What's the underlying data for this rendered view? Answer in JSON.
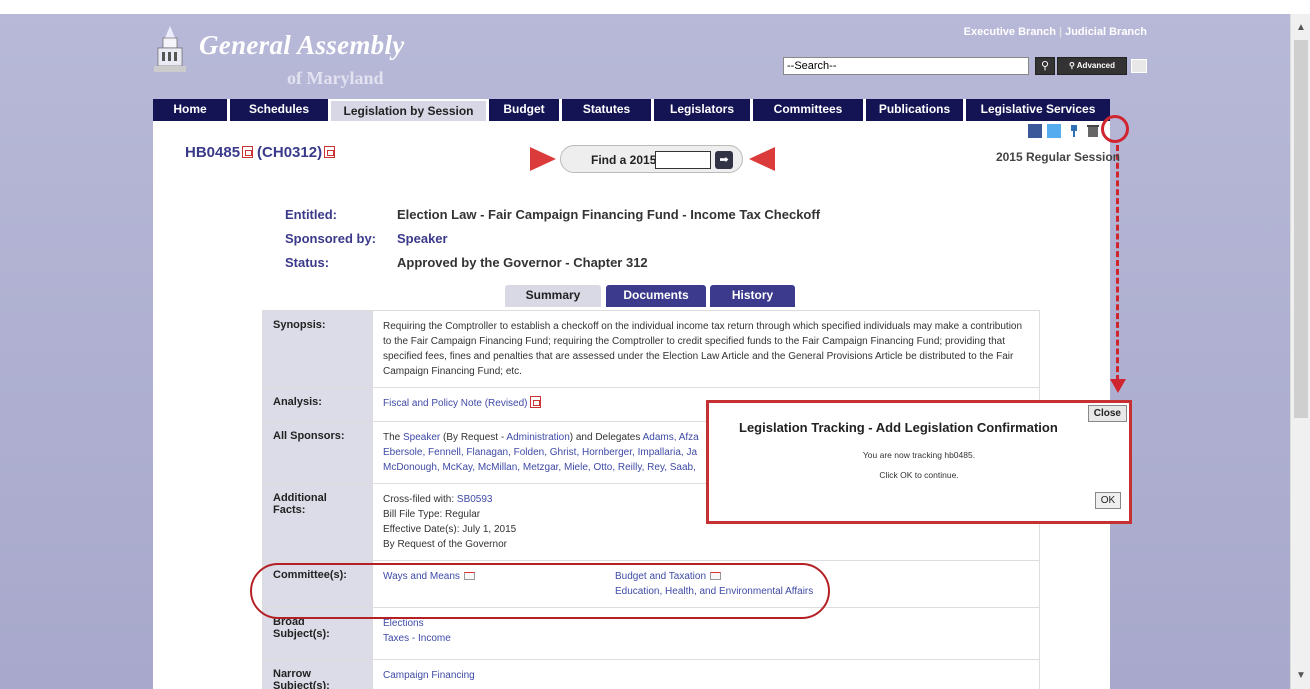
{
  "header": {
    "site_title": "General Assembly",
    "site_subtitle": "of Maryland",
    "branch_links": [
      "Executive Branch",
      "Judicial Branch"
    ],
    "search_placeholder": "--Search--",
    "advanced_label": "Advanced"
  },
  "nav": {
    "items": [
      "Home",
      "Schedules",
      "Legislation by Session",
      "Budget",
      "Statutes",
      "Legislators",
      "Committees",
      "Publications",
      "Legislative Services"
    ]
  },
  "bill": {
    "number": "HB0485",
    "chapter": "(CH0312)",
    "find_label": "Find a 2015 Bill:",
    "session": "2015 Regular Session"
  },
  "meta": {
    "entitled_label": "Entitled:",
    "entitled_value": "Election Law - Fair Campaign Financing Fund - Income Tax Checkoff",
    "sponsored_label": "Sponsored by:",
    "sponsored_value": "Speaker",
    "status_label": "Status:",
    "status_value": "Approved by the Governor - Chapter 312"
  },
  "tabs": [
    "Summary",
    "Documents",
    "History"
  ],
  "rows": {
    "synopsis_label": "Synopsis:",
    "synopsis_text": "Requiring the Comptroller to establish a checkoff on the individual income tax return through which specified individuals may make a contribution to the Fair Campaign Financing Fund; requiring the Comptroller to credit specified funds to the Fair Campaign Financing Fund; providing that specified fees, fines and penalties that are assessed under the Election Law Article and the General Provisions Article be distributed to the Fair Campaign Financing Fund; etc.",
    "analysis_label": "Analysis:",
    "analysis_link": "Fiscal and Policy Note (Revised)",
    "sponsors_label": "All Sponsors:",
    "sponsors_line1_pre": "The ",
    "sponsors_speaker": "Speaker",
    "sponsors_byrequest": " (By Request - ",
    "sponsors_admin": "Administration",
    "sponsors_delegates": ") and Delegates ",
    "sponsors_line1_names": "Adams, Afza",
    "sponsors_line2": "Ebersole, Fennell, Flanagan, Folden, Ghrist, Hornberger, Impallaria, Ja",
    "sponsors_line3": "McDonough, McKay, McMillan, Metzgar, Miele, Otto, Reilly, Rey, Saab,",
    "facts_label": "Additional Facts:",
    "facts_crossfiled_label": "Cross-filed with: ",
    "facts_crossfiled_value": "SB0593",
    "facts_bill_type": "Bill File Type: Regular",
    "facts_effective": "Effective Date(s): July 1, 2015",
    "facts_request": "By Request of the Governor",
    "committees_label": "Committee(s):",
    "committee_1": "Ways and Means",
    "committee_2": "Budget and Taxation",
    "committee_3": "Education, Health, and Environmental Affairs",
    "broad_label": "Broad Subject(s):",
    "broad_1": "Elections",
    "broad_2": "Taxes - Income",
    "narrow_label": "Narrow Subject(s):",
    "narrow_1": "Campaign Financing"
  },
  "dialog": {
    "title": "Legislation Tracking - Add Legislation Confirmation",
    "close": "Close",
    "message1": "You are now tracking hb0485.",
    "message2": "Click OK to continue.",
    "ok": "OK"
  },
  "colors": {
    "nav_bg": "#141455",
    "link": "#3f4aa6",
    "annotation_red": "#d0252f",
    "header_bg": "#b8b9d8"
  }
}
